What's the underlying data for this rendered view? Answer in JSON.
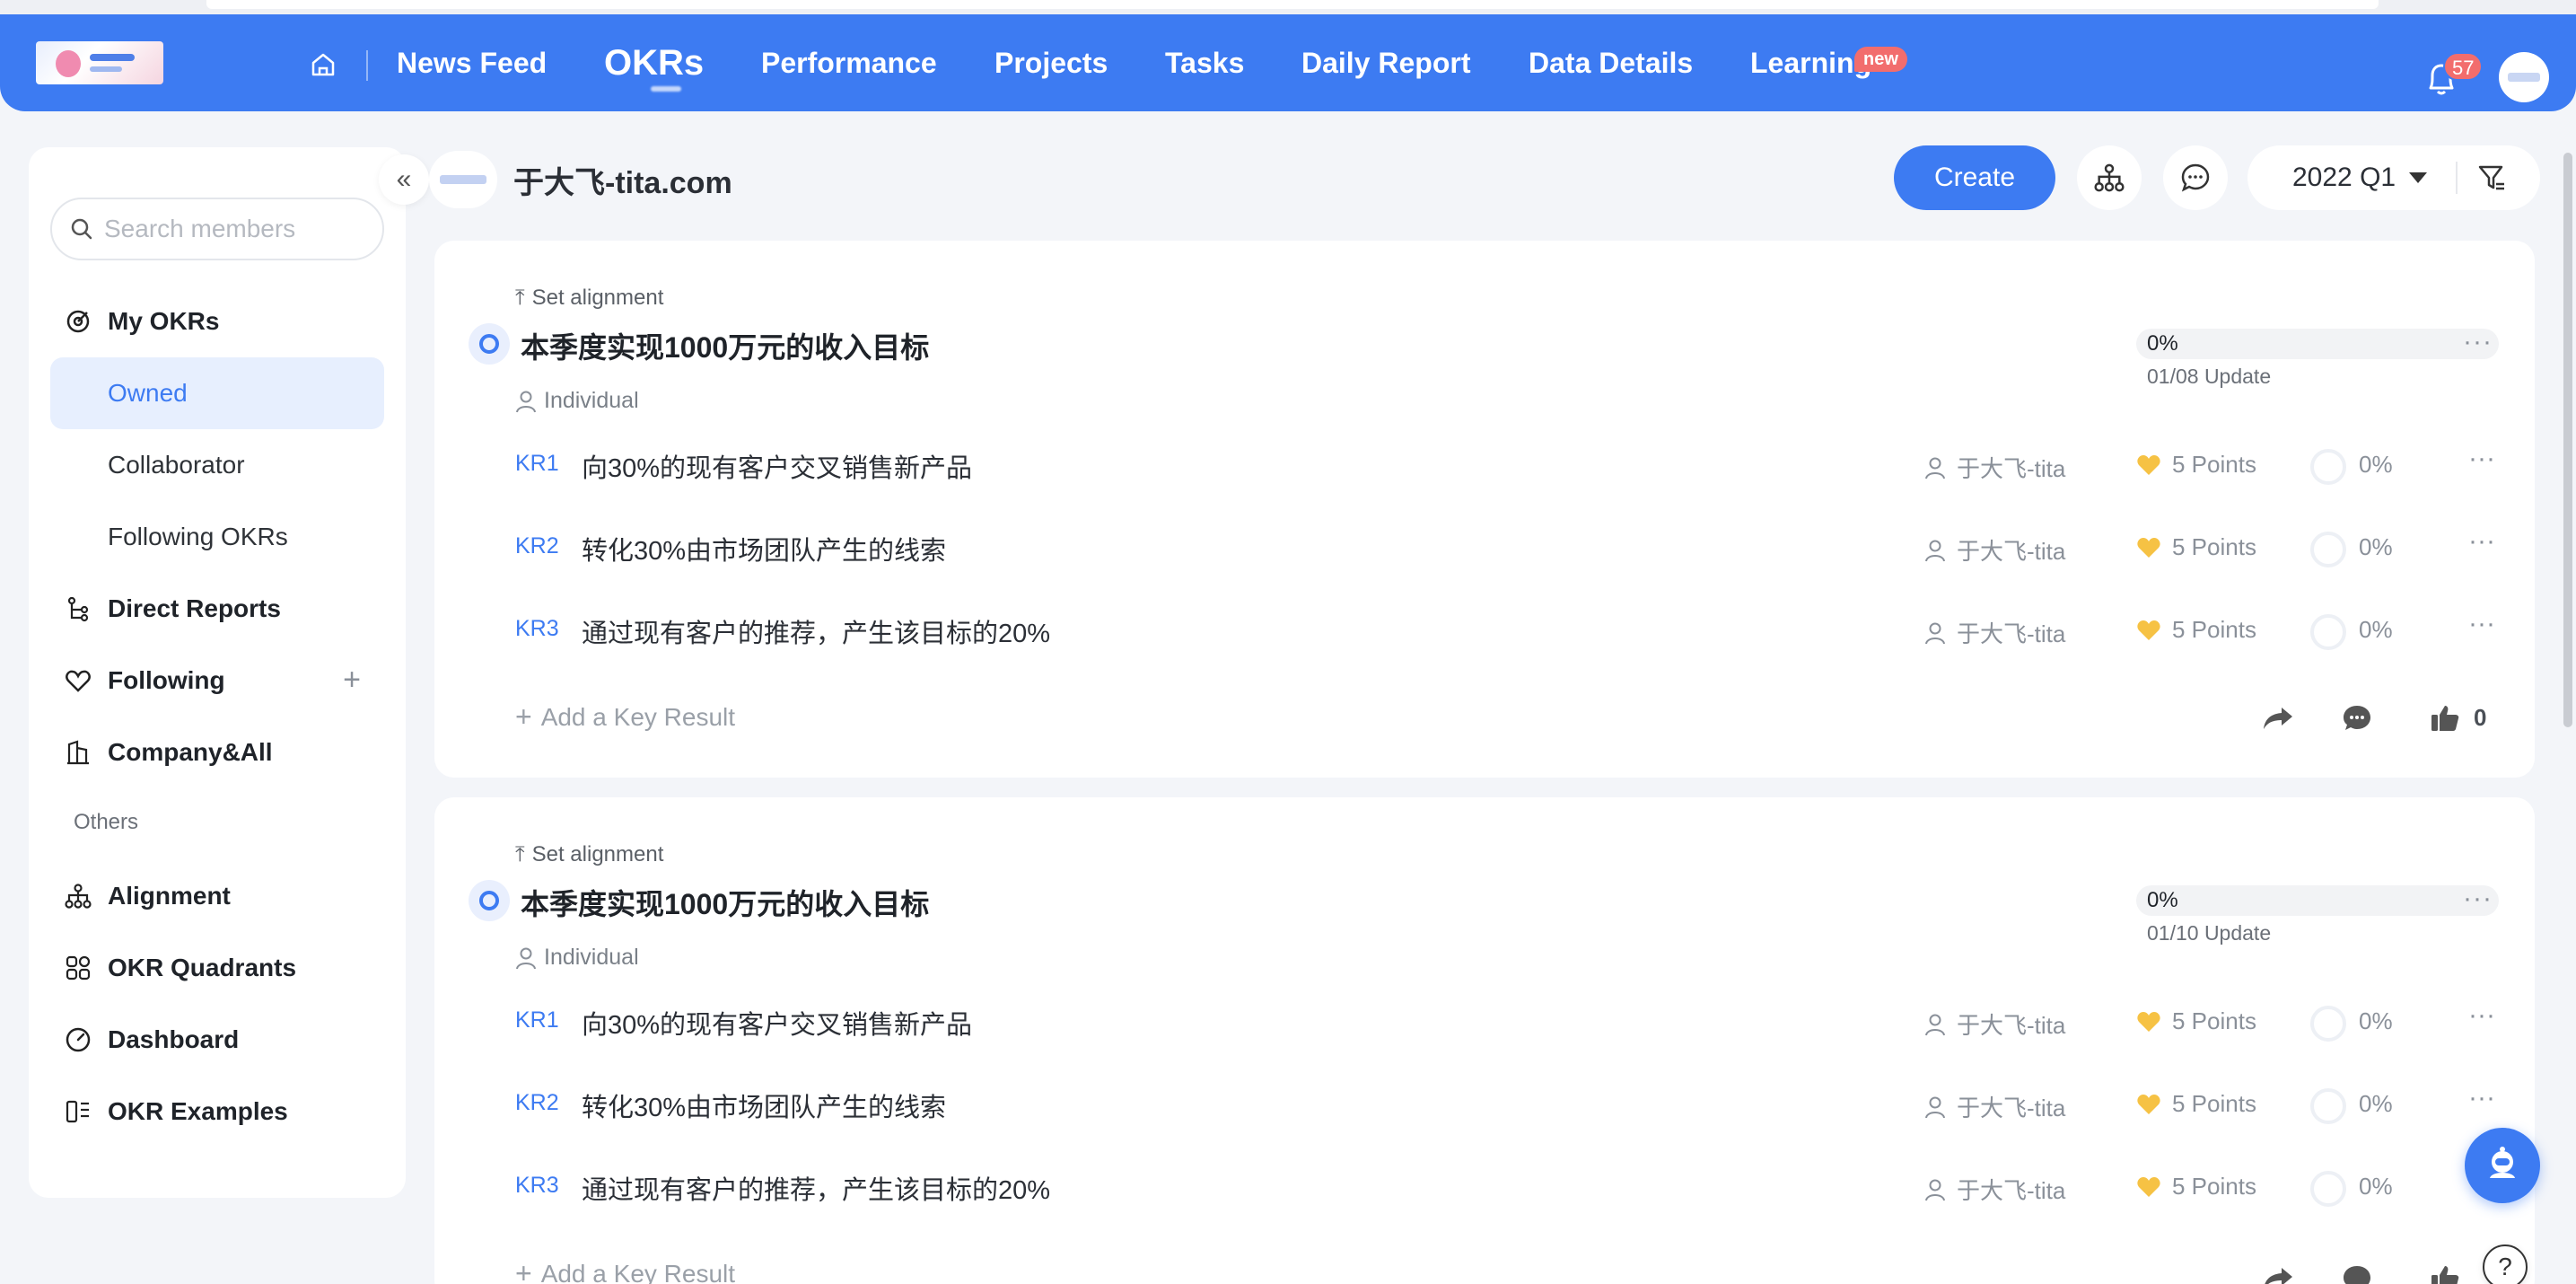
{
  "nav": {
    "home_icon": "home-icon",
    "items": [
      {
        "label": "News Feed"
      },
      {
        "label": "OKRs",
        "active": true
      },
      {
        "label": "Performance"
      },
      {
        "label": "Projects"
      },
      {
        "label": "Tasks"
      },
      {
        "label": "Daily Report"
      },
      {
        "label": "Data Details"
      },
      {
        "label": "Learning",
        "badge": "new"
      }
    ],
    "notification_count": "57",
    "accent_color": "#3d7bf2"
  },
  "sidebar": {
    "search_placeholder": "Search members",
    "items": [
      {
        "label": "My OKRs",
        "icon": "target-icon"
      },
      {
        "label": "Owned",
        "selected": true
      },
      {
        "label": "Collaborator"
      },
      {
        "label": "Following OKRs"
      },
      {
        "label": "Direct Reports",
        "icon": "org-branch-icon"
      },
      {
        "label": "Following",
        "icon": "heart-icon",
        "action": "+"
      },
      {
        "label": "Company&All",
        "icon": "building-icon"
      },
      {
        "caption": "Others"
      },
      {
        "label": "Alignment",
        "icon": "hierarchy-icon"
      },
      {
        "label": "OKR Quadrants",
        "icon": "quadrant-icon"
      },
      {
        "label": "Dashboard",
        "icon": "gauge-icon"
      },
      {
        "label": "OKR Examples",
        "icon": "examples-icon"
      }
    ]
  },
  "header": {
    "owner_name": "于大飞-tita.com",
    "create_label": "Create",
    "period": "2022 Q1"
  },
  "okrs": [
    {
      "set_alignment": "Set alignment",
      "title": "本季度实现1000万元的收入目标",
      "type": "Individual",
      "progress_label": "0%",
      "progress": 0,
      "update": "01/08 Update",
      "key_results": [
        {
          "tag": "KR1",
          "text": "向30%的现有客户交叉销售新产品",
          "owner": "于大飞-tita",
          "points": "5 Points",
          "progress": "0%"
        },
        {
          "tag": "KR2",
          "text": "转化30%由市场团队产生的线索",
          "owner": "于大飞-tita",
          "points": "5 Points",
          "progress": "0%"
        },
        {
          "tag": "KR3",
          "text": "通过现有客户的推荐，产生该目标的20%",
          "owner": "于大飞-tita",
          "points": "5 Points",
          "progress": "0%"
        }
      ],
      "add_kr": "Add a Key Result",
      "likes": "0"
    },
    {
      "set_alignment": "Set alignment",
      "title": "本季度实现1000万元的收入目标",
      "type": "Individual",
      "progress_label": "0%",
      "progress": 0,
      "update": "01/10 Update",
      "key_results": [
        {
          "tag": "KR1",
          "text": "向30%的现有客户交叉销售新产品",
          "owner": "于大飞-tita",
          "points": "5 Points",
          "progress": "0%"
        },
        {
          "tag": "KR2",
          "text": "转化30%由市场团队产生的线索",
          "owner": "于大飞-tita",
          "points": "5 Points",
          "progress": "0%"
        },
        {
          "tag": "KR3",
          "text": "通过现有客户的推荐，产生该目标的20%",
          "owner": "于大飞-tita",
          "points": "5 Points",
          "progress": "0%"
        }
      ],
      "add_kr": "Add a Key Result"
    }
  ]
}
